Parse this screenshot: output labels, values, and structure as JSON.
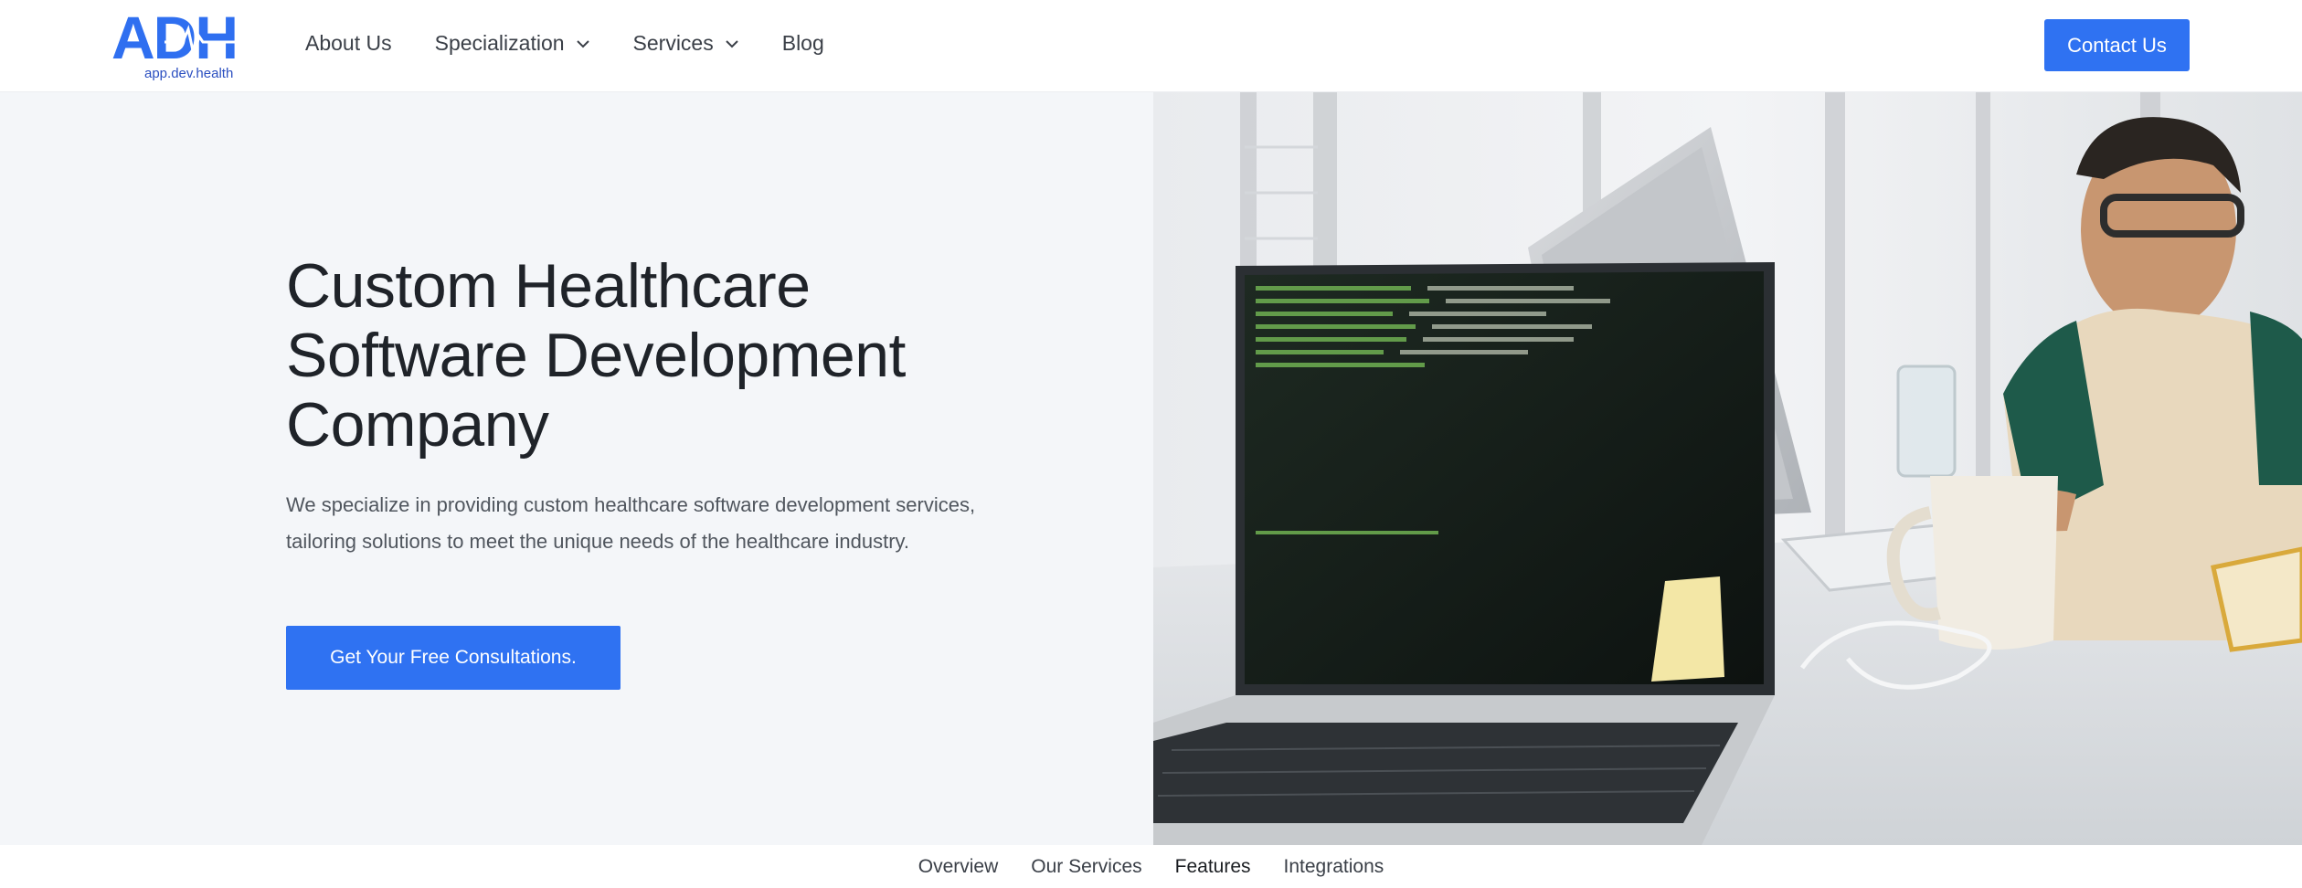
{
  "header": {
    "logo_text": "ADH",
    "logo_subtext": "app.dev.health",
    "nav": [
      {
        "label": "About Us",
        "has_dropdown": false
      },
      {
        "label": "Specialization",
        "has_dropdown": true
      },
      {
        "label": "Services",
        "has_dropdown": true
      },
      {
        "label": "Blog",
        "has_dropdown": false
      }
    ],
    "contact_label": "Contact Us"
  },
  "hero": {
    "title_lines": [
      "Custom Healthcare",
      "Software Development",
      "Company"
    ],
    "description": "We specialize in providing custom healthcare software development services, tailoring solutions to meet the unique needs of the healthcare industry.",
    "cta_label": "Get Your Free Consultations."
  },
  "subnav": [
    "Overview",
    "Our Services",
    "Features",
    "Integrations"
  ],
  "colors": {
    "accent": "#2f72f2",
    "logo_blue": "#2f6ff0",
    "hero_bg": "#f4f6f9",
    "title": "#1f2329",
    "body_text": "#50565e"
  },
  "icons": {
    "dropdown": "chevron-down-icon"
  }
}
